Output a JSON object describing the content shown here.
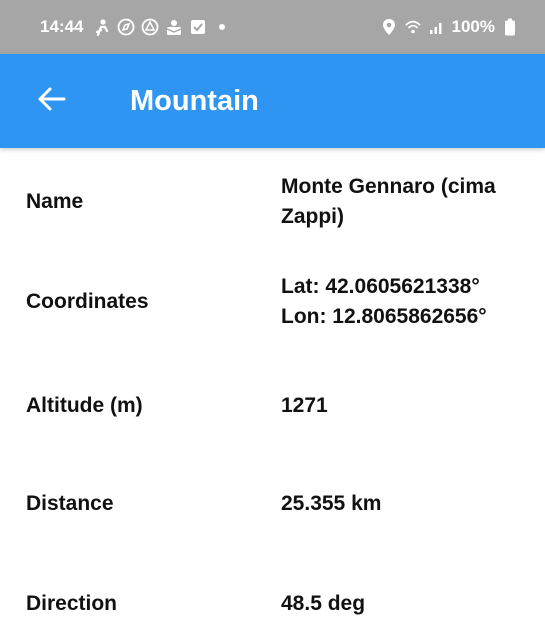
{
  "status_bar": {
    "time": "14:44",
    "battery": "100%",
    "left_icons": [
      "person-icon",
      "compass-icon",
      "drive-icon",
      "inbox-icon",
      "checkbox-icon",
      "dot-icon"
    ],
    "right_icons": [
      "location-pin-icon",
      "wifi-icon",
      "signal-icon",
      "battery-icon"
    ]
  },
  "app_bar": {
    "title": "Mountain",
    "back_icon": "arrow-left-icon",
    "color": "#2f95f2"
  },
  "details": {
    "rows": [
      {
        "label": "Name",
        "value": "Monte Gennaro (cima Zappi)"
      },
      {
        "label": "Coordinates",
        "value_line1": "Lat: 42.0605621338°",
        "value_line2": "Lon: 12.8065862656°"
      },
      {
        "label": "Altitude (m)",
        "value": "1271"
      },
      {
        "label": "Distance",
        "value": "25.355 km"
      },
      {
        "label": "Direction",
        "value": "48.5 deg"
      }
    ]
  }
}
